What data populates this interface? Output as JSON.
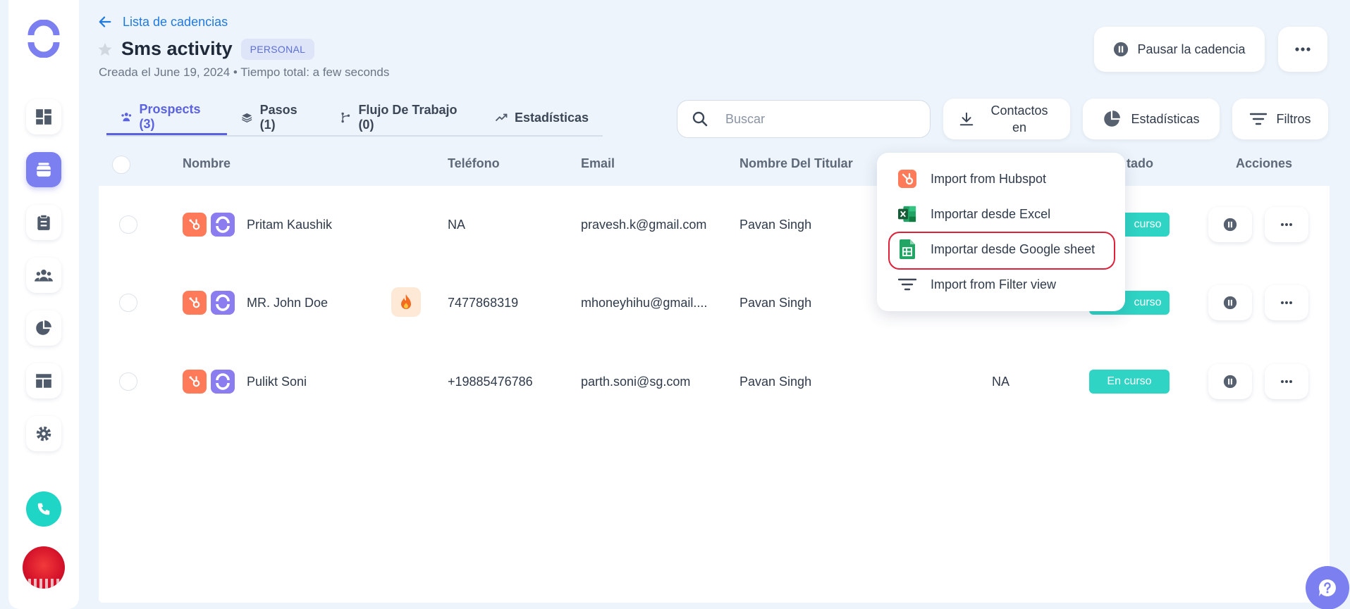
{
  "header": {
    "back_label": "Lista de cadencias",
    "title": "Sms activity",
    "badge": "PERSONAL",
    "subtitle": "Creada el June 19, 2024 • Tiempo total: a few seconds",
    "pause_label": "Pausar la cadencia"
  },
  "tabs": [
    {
      "label": "Prospects (3)",
      "icon": "users-icon",
      "active": true
    },
    {
      "label": "Pasos (1)",
      "icon": "layers-icon"
    },
    {
      "label": "Flujo De Trabajo (0)",
      "icon": "workflow-icon"
    },
    {
      "label": "Estadísticas",
      "icon": "trend-icon"
    }
  ],
  "toolbar": {
    "search_placeholder": "Buscar",
    "import_label_line1": "Contactos",
    "import_label_line2": "en",
    "stats_label": "Estadísticas",
    "filter_label": "Filtros"
  },
  "table": {
    "columns": [
      "Nombre",
      "Teléfono",
      "Email",
      "Nombre Del Titular",
      "tado",
      "Acciones"
    ],
    "rows": [
      {
        "name": "Pritam Kaushik",
        "phone": "NA",
        "email": "pravesh.k@gmail.com",
        "owner": "Pavan Singh",
        "extra": "",
        "status": "curso"
      },
      {
        "name": "MR. John Doe",
        "phone": "7477868319",
        "email": "mhoneyhihu@gmail....",
        "owner": "Pavan Singh",
        "extra": "",
        "status": "curso"
      },
      {
        "name": "Pulikt Soni",
        "phone": "+19885476786",
        "email": "parth.soni@sg.com",
        "owner": "Pavan Singh",
        "extra": "NA",
        "status": "En curso"
      }
    ]
  },
  "dropdown": {
    "items": [
      {
        "label": "Import from Hubspot",
        "icon": "hubspot-icon"
      },
      {
        "label": "Importar desde Excel",
        "icon": "excel-icon"
      },
      {
        "label": "Importar desde Google sheet",
        "icon": "google-sheets-icon",
        "highlighted": true
      },
      {
        "label": "Import from Filter view",
        "icon": "filter-lines-icon"
      }
    ]
  },
  "colors": {
    "accent": "#5b62e0",
    "link": "#1f7ae0",
    "status": "#2fd4c4",
    "hubspot": "#ff7a59",
    "highlight": "#e0203a"
  }
}
